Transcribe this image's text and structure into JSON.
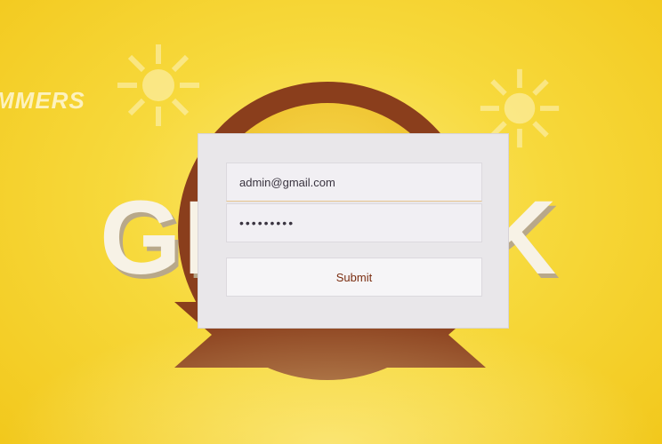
{
  "background": {
    "banner_fragment": "MMERS",
    "logo_left_letters": "GE",
    "logo_right_letter": "K"
  },
  "login": {
    "email_value": "admin@gmail.com",
    "password_value": "•••••••••",
    "submit_label": "Submit"
  },
  "colors": {
    "background_yellow": "#f7d93c",
    "badge_brown": "#8a3e1c",
    "card_gray": "#e9e7ea",
    "button_text": "#7a2d10"
  }
}
